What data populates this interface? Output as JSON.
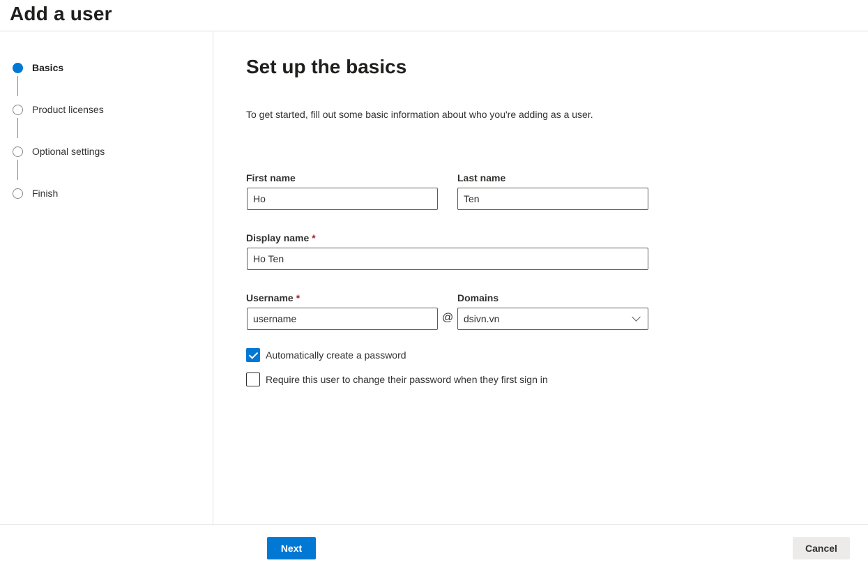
{
  "page": {
    "title": "Add a user"
  },
  "steps": [
    {
      "label": "Basics",
      "state": "active"
    },
    {
      "label": "Product licenses",
      "state": "pending"
    },
    {
      "label": "Optional settings",
      "state": "pending"
    },
    {
      "label": "Finish",
      "state": "pending"
    }
  ],
  "main": {
    "title": "Set up the basics",
    "intro": "To get started, fill out some basic information about who you're adding as a user."
  },
  "form": {
    "first_name": {
      "label": "First name",
      "value": "Ho"
    },
    "last_name": {
      "label": "Last name",
      "value": "Ten"
    },
    "display_name": {
      "label": "Display name",
      "required_mark": "*",
      "value": "Ho Ten"
    },
    "username": {
      "label": "Username",
      "required_mark": "*",
      "value": "username"
    },
    "at_symbol": "@",
    "domains": {
      "label": "Domains",
      "value": "dsivn.vn"
    },
    "auto_password": {
      "label": "Automatically create a password",
      "checked": true
    },
    "require_change": {
      "label": "Require this user to change their password when they first sign in",
      "checked": false
    }
  },
  "footer": {
    "next_label": "Next",
    "cancel_label": "Cancel"
  },
  "colors": {
    "accent": "#0078d4",
    "required": "#a4262c",
    "border": "#605e5c",
    "secondary_button": "#edebe9"
  }
}
